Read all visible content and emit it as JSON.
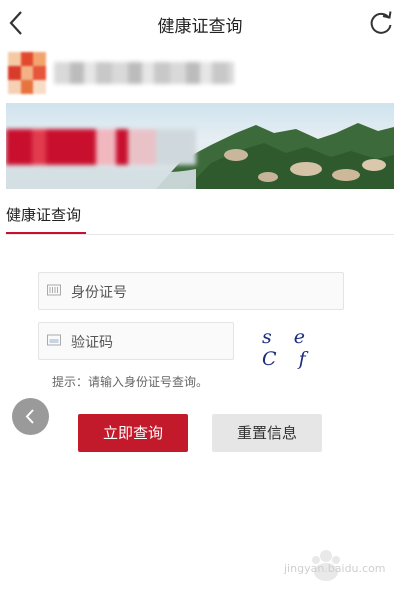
{
  "header": {
    "title": "健康证查询",
    "back_icon": "chevron-left-icon",
    "refresh_icon": "refresh-icon"
  },
  "tabs": [
    {
      "label": "健康证查询",
      "active": true
    }
  ],
  "form": {
    "id_placeholder": "身份证号",
    "captcha_placeholder": "验证码",
    "captcha_text": "s e C f",
    "hint": "提示：请输入身份证号查询。"
  },
  "buttons": {
    "query_label": "立即查询",
    "reset_label": "重置信息"
  },
  "colors": {
    "accent": "#c8102e",
    "query_button": "#c21a2b",
    "reset_button": "#e6e6e6"
  },
  "watermark": {
    "text": "jingyan.baidu.com"
  }
}
